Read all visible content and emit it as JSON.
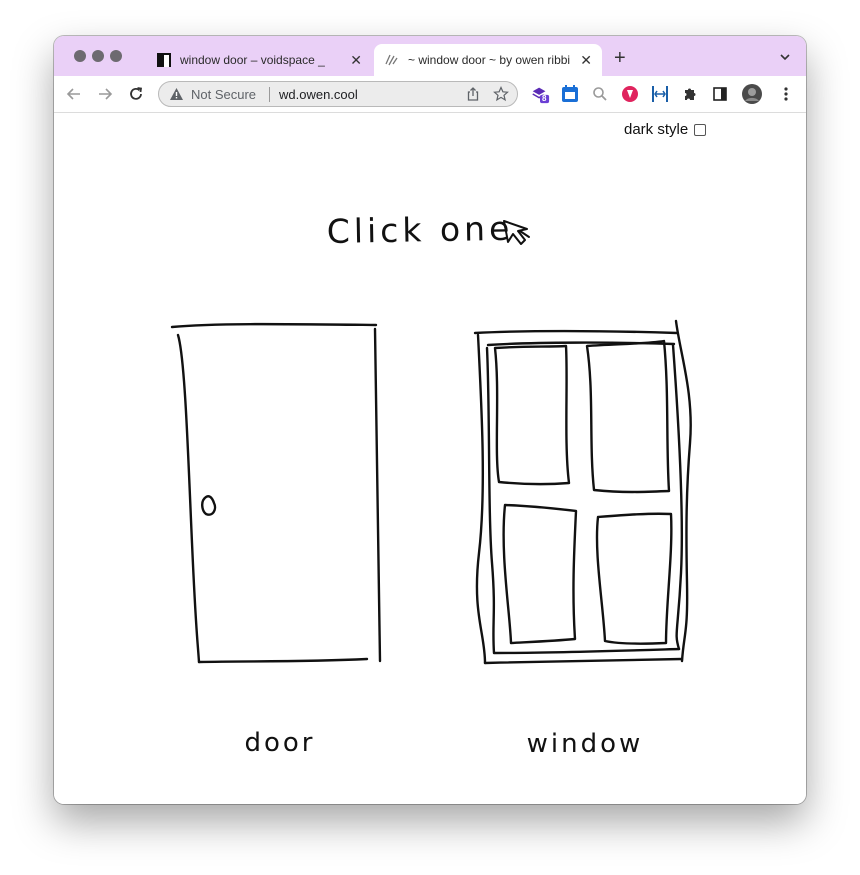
{
  "browser": {
    "tabs": [
      {
        "title": "window door – voidspace _",
        "favicon": "voidspace-favicon"
      },
      {
        "title": "~ window door ~ by owen ribbi",
        "favicon": "scribble-favicon"
      }
    ],
    "active_tab": 1,
    "address": {
      "security_text": "Not Secure",
      "url": "wd.owen.cool"
    },
    "extension_badge": "8",
    "tab_color": "#ead0f7"
  },
  "page": {
    "dark_style_label": "dark style",
    "dark_style_checked": false,
    "headline": "Click one",
    "options": [
      {
        "label": "door"
      },
      {
        "label": "window"
      }
    ]
  }
}
